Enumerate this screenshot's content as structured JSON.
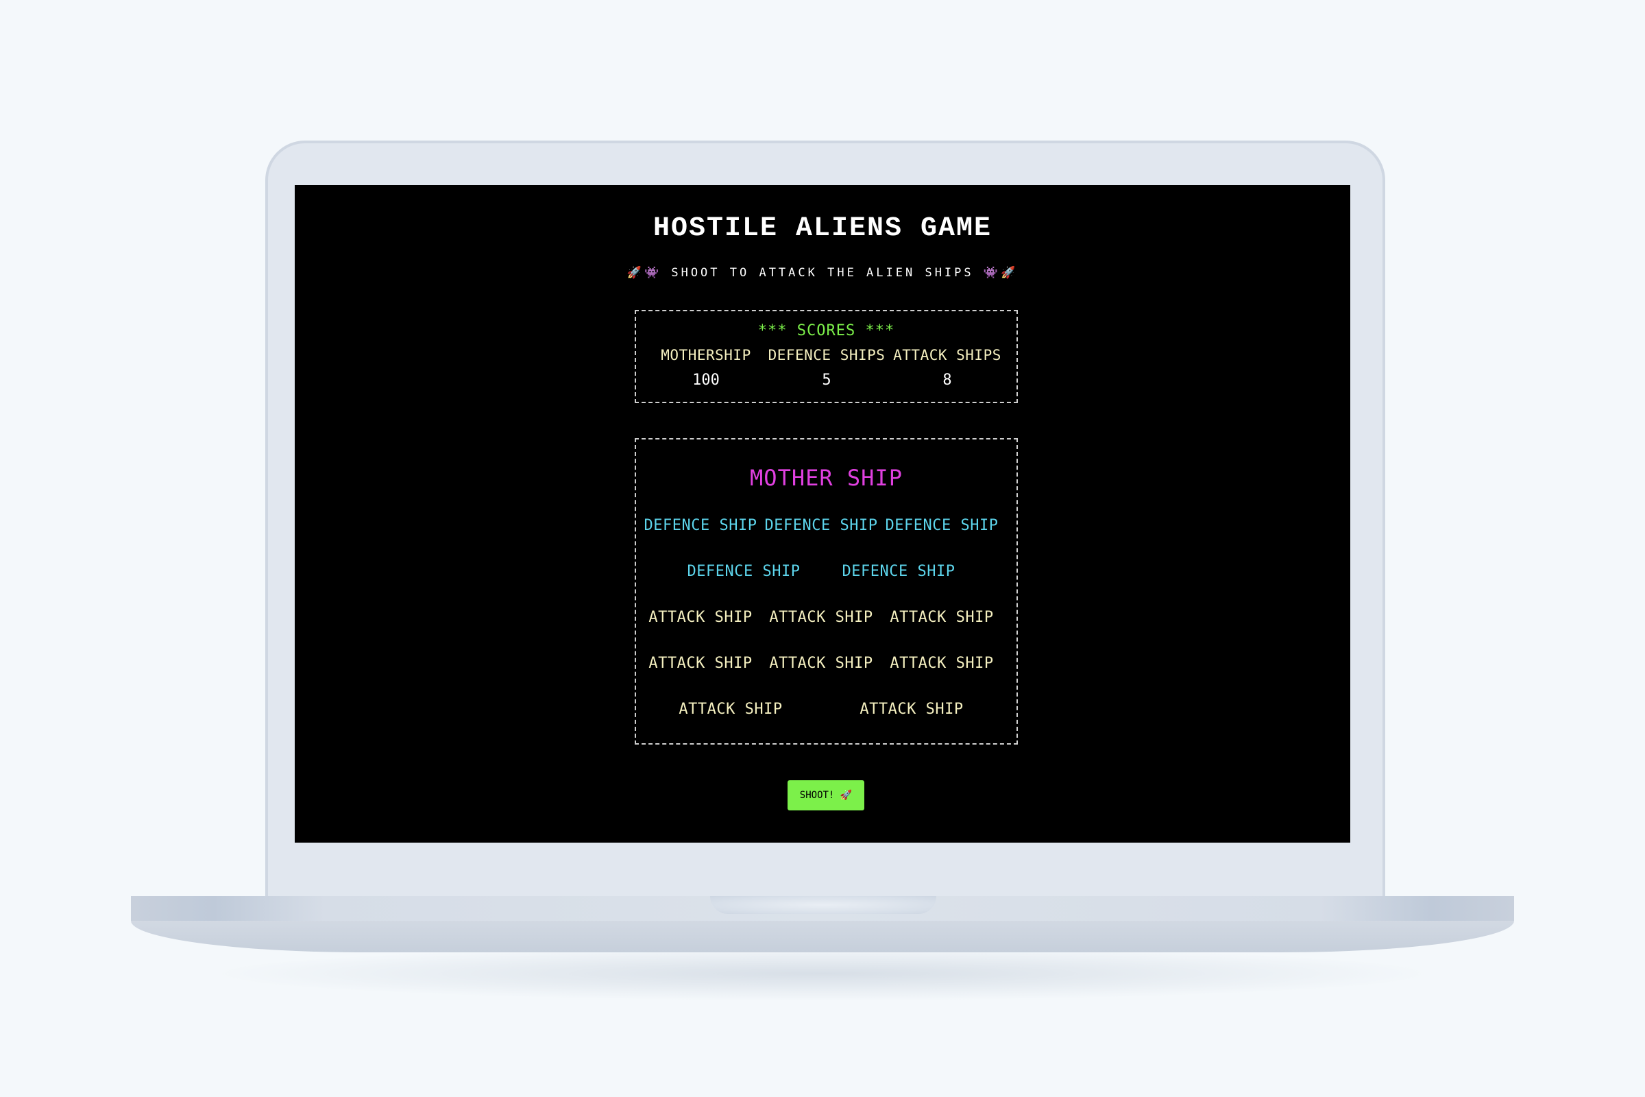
{
  "game": {
    "title": "Hostile Aliens Game",
    "subtitle": "🚀👾 Shoot to attack the alien ships 👾🚀"
  },
  "scores": {
    "title": "*** Scores ***",
    "mothership": {
      "label": "Mothership",
      "value": "100"
    },
    "defence": {
      "label": "Defence Ships",
      "value": "5"
    },
    "attack": {
      "label": "Attack Ships",
      "value": "8"
    }
  },
  "ships": {
    "mothership": "Mother Ship",
    "defence": [
      "Defence Ship",
      "Defence Ship",
      "Defence Ship",
      "Defence Ship",
      "Defence Ship"
    ],
    "attack": [
      "Attack Ship",
      "Attack Ship",
      "Attack Ship",
      "Attack Ship",
      "Attack Ship",
      "Attack Ship",
      "Attack Ship",
      "Attack Ship"
    ]
  },
  "controls": {
    "shoot_label": "Shoot! 🚀"
  },
  "colors": {
    "background": "#000000",
    "title": "#ffffff",
    "scores_title": "#7cf04a",
    "mothership": "#e040e0",
    "defence_ship": "#5dd5ec",
    "attack_ship": "#f5f0c0",
    "shoot_button": "#7cf04a"
  }
}
